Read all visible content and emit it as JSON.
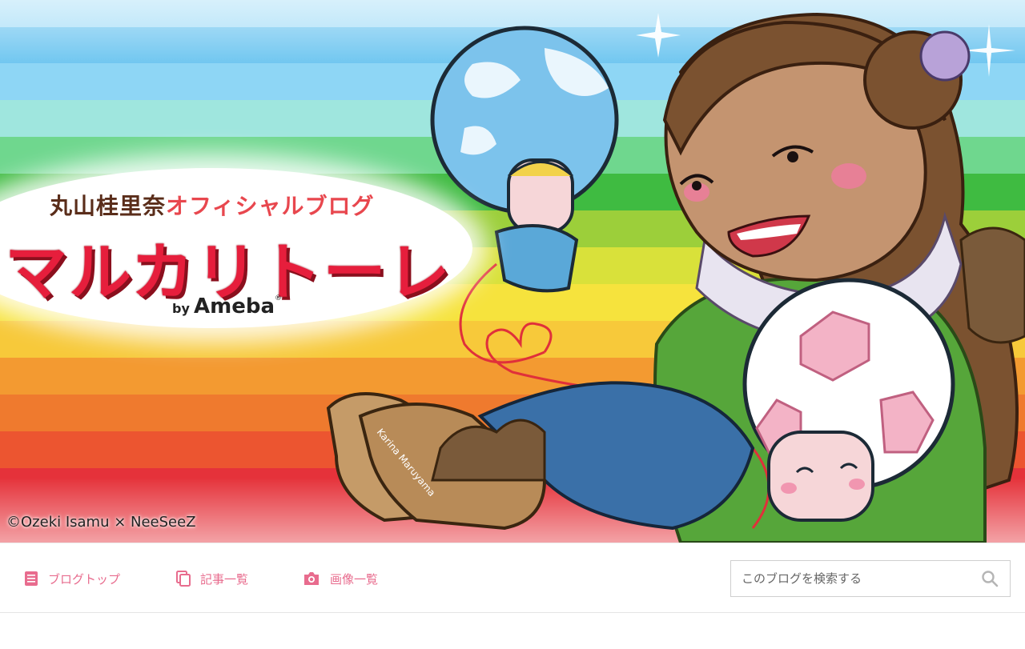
{
  "header": {
    "subtitle_name": "丸山桂里奈",
    "subtitle_rest": "オフィシャルブログ",
    "title": "マルカリトーレ",
    "by": "by",
    "brand": "Ameba",
    "brand_mark": "®",
    "credit": "©Ozeki Isamu × NeeSeeZ",
    "boot_text": "Karina Maruyama",
    "stripe_colors": [
      "#6fc6f0",
      "#8ed6f5",
      "#a9e3f3",
      "#8fe3c9",
      "#6fd78e",
      "#58c247",
      "#9ccf3a",
      "#e6e538",
      "#f7c93a",
      "#f39a31",
      "#f07a2f",
      "#ef5a2e",
      "#e5323a"
    ]
  },
  "nav": {
    "items": [
      {
        "label": "ブログトップ",
        "icon": "document-icon"
      },
      {
        "label": "記事一覧",
        "icon": "copy-icon"
      },
      {
        "label": "画像一覧",
        "icon": "camera-icon"
      }
    ],
    "accent_color": "#e86c8e"
  },
  "search": {
    "placeholder": "このブログを検索する",
    "icon": "search-icon"
  }
}
